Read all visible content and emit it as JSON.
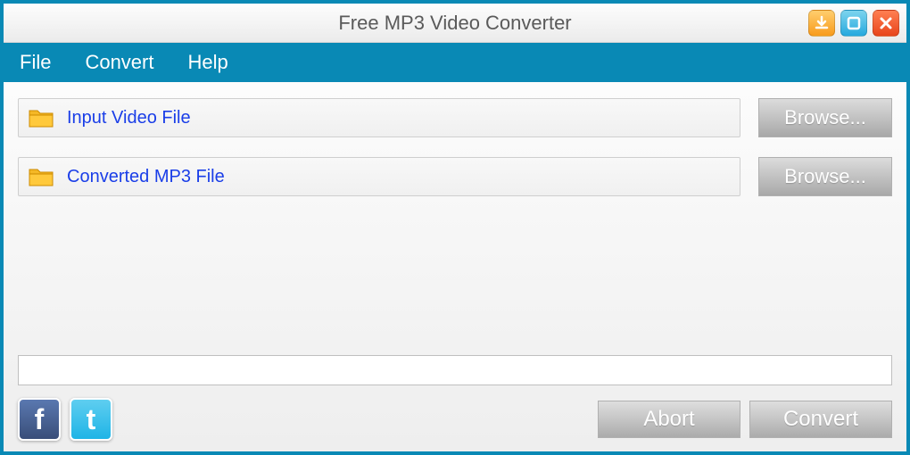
{
  "title": "Free MP3 Video Converter",
  "menu": {
    "file": "File",
    "convert": "Convert",
    "help": "Help"
  },
  "input": {
    "label": "Input Video File",
    "browse": "Browse..."
  },
  "output": {
    "label": "Converted MP3 File",
    "browse": "Browse..."
  },
  "actions": {
    "abort": "Abort",
    "convert": "Convert"
  },
  "icons": {
    "download": "download-icon",
    "maximize": "maximize-icon",
    "close": "close-icon",
    "folder": "folder-icon",
    "facebook": "facebook-icon",
    "twitter": "twitter-icon"
  }
}
